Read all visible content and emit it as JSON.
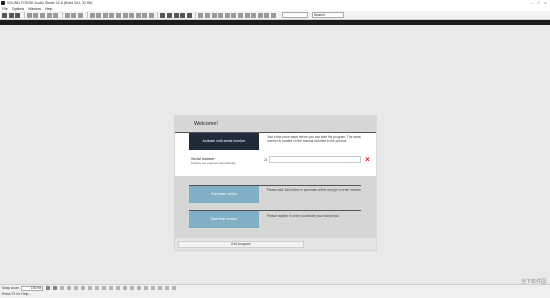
{
  "window": {
    "title": "SOUND FORGE Audio Studio 12.6 (Build 341, 32 Bit)",
    "controls": [
      "–",
      "□",
      "×"
    ]
  },
  "menu": [
    "File",
    "Options",
    "Window",
    "Help"
  ],
  "toolbar": {
    "icons": [
      "new-icon",
      "open-icon",
      "save-icon",
      "cut-icon",
      "copy-icon",
      "paste-icon",
      "undo-icon",
      "redo-icon",
      "play-icon",
      "record-icon",
      "zoom-icon"
    ],
    "search_value": "Search"
  },
  "dialog": {
    "title": "Welcome!",
    "activate_label": "Activate with serial number",
    "activate_help": "Just a few more steps before you can start the program. The serial number is located on the manual included in the product.",
    "serial_label": "Serial number:",
    "serial_hint": "Dashes are entered automatically",
    "serial_prefix": "JI",
    "serial_value": "",
    "buy_label": "Purchase online",
    "buy_help": "Please click this button to purchase online and get a serial number.",
    "trial_label": "Start trial version",
    "trial_help": "Please register in order to activate your trial period.",
    "exit_label": "Exit program"
  },
  "status": {
    "snap_label": "Snap zoom",
    "zoom_value": "100 Hz",
    "help_text": "Press F1 for Help..."
  },
  "watermark": "当下软件园",
  "colors": {
    "activate_bg": "#1f2b38",
    "option_btn_bg": "#7fb0c6",
    "clear_icon": "#e01010"
  }
}
